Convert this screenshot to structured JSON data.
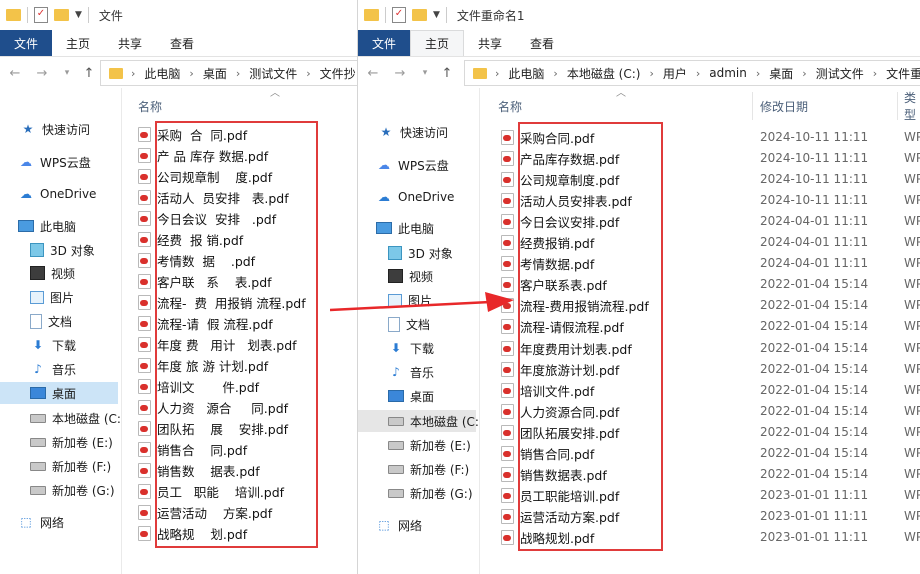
{
  "left": {
    "title": "文件",
    "ribbon_tabs": [
      "文件",
      "主页",
      "共享",
      "查看"
    ],
    "breadcrumb": [
      "此电脑",
      "桌面",
      "测试文件",
      "文件抄"
    ],
    "column_name": "名称",
    "nav": [
      {
        "label": "快速访问",
        "icon": "star-icon"
      },
      {
        "label": "WPS云盘",
        "icon": "cloud-icon"
      },
      {
        "label": "OneDrive",
        "icon": "onedrive-icon"
      },
      {
        "label": "此电脑",
        "icon": "pc-icon"
      },
      {
        "label": "3D 对象",
        "icon": "3d-objects-icon"
      },
      {
        "label": "视频",
        "icon": "video-icon"
      },
      {
        "label": "图片",
        "icon": "pictures-icon"
      },
      {
        "label": "文档",
        "icon": "documents-icon"
      },
      {
        "label": "下载",
        "icon": "download-icon"
      },
      {
        "label": "音乐",
        "icon": "music-icon"
      },
      {
        "label": "桌面",
        "icon": "desktop-icon"
      },
      {
        "label": "本地磁盘 (C:",
        "icon": "drive-icon"
      },
      {
        "label": "新加卷 (E:)",
        "icon": "drive-icon"
      },
      {
        "label": "新加卷 (F:)",
        "icon": "drive-icon"
      },
      {
        "label": "新加卷 (G:)",
        "icon": "drive-icon"
      },
      {
        "label": "网络",
        "icon": "network-icon"
      }
    ],
    "files": [
      "采购  合  同.pdf",
      "产 品 库存 数据.pdf",
      "公司规章制    度.pdf",
      "活动人  员安排   表.pdf",
      "今日会议  安排   .pdf",
      "经费  报 销.pdf",
      "考情数  据    .pdf",
      "客户联   系    表.pdf",
      "流程-  费  用报销 流程.pdf",
      "流程-请  假 流程.pdf",
      "年度 费   用计   划表.pdf",
      "年度 旅 游 计划.pdf",
      "培训文       件.pdf",
      "人力资   源合     同.pdf",
      "团队拓    展    安排.pdf",
      "销售合    同.pdf",
      "销售数    据表.pdf",
      "员工   职能    培训.pdf",
      "运营活动    方案.pdf",
      "战略规    划.pdf"
    ]
  },
  "right": {
    "title": "文件重命名1",
    "ribbon_tabs": [
      "文件",
      "主页",
      "共享",
      "查看"
    ],
    "breadcrumb": [
      "此电脑",
      "本地磁盘 (C:)",
      "用户",
      "admin",
      "桌面",
      "测试文件",
      "文件重"
    ],
    "column_name": "名称",
    "column_date": "修改日期",
    "column_type": "类型",
    "nav": [
      {
        "label": "快速访问",
        "icon": "star-icon"
      },
      {
        "label": "WPS云盘",
        "icon": "cloud-icon"
      },
      {
        "label": "OneDrive",
        "icon": "onedrive-icon"
      },
      {
        "label": "此电脑",
        "icon": "pc-icon"
      },
      {
        "label": "3D 对象",
        "icon": "3d-objects-icon"
      },
      {
        "label": "视频",
        "icon": "video-icon"
      },
      {
        "label": "图片",
        "icon": "pictures-icon"
      },
      {
        "label": "文档",
        "icon": "documents-icon"
      },
      {
        "label": "下载",
        "icon": "download-icon"
      },
      {
        "label": "音乐",
        "icon": "music-icon"
      },
      {
        "label": "桌面",
        "icon": "desktop-icon"
      },
      {
        "label": "本地磁盘 (C:",
        "icon": "drive-icon"
      },
      {
        "label": "新加卷 (E:)",
        "icon": "drive-icon"
      },
      {
        "label": "新加卷 (F:)",
        "icon": "drive-icon"
      },
      {
        "label": "新加卷 (G:)",
        "icon": "drive-icon"
      },
      {
        "label": "网络",
        "icon": "network-icon"
      }
    ],
    "files": [
      {
        "name": "采购合同.pdf",
        "date": "2024-10-11 11:11",
        "type": "WP"
      },
      {
        "name": "产品库存数据.pdf",
        "date": "2024-10-11 11:11",
        "type": "WP"
      },
      {
        "name": "公司规章制度.pdf",
        "date": "2024-10-11 11:11",
        "type": "WP"
      },
      {
        "name": "活动人员安排表.pdf",
        "date": "2024-10-11 11:11",
        "type": "WP"
      },
      {
        "name": "今日会议安排.pdf",
        "date": "2024-04-01 11:11",
        "type": "WP"
      },
      {
        "name": "经费报销.pdf",
        "date": "2024-04-01 11:11",
        "type": "WP"
      },
      {
        "name": "考情数据.pdf",
        "date": "2024-04-01 11:11",
        "type": "WP"
      },
      {
        "name": "客户联系表.pdf",
        "date": "2022-01-04 15:14",
        "type": "WP"
      },
      {
        "name": "流程-费用报销流程.pdf",
        "date": "2022-01-04 15:14",
        "type": "WP"
      },
      {
        "name": "流程-请假流程.pdf",
        "date": "2022-01-04 15:14",
        "type": "WP"
      },
      {
        "name": "年度费用计划表.pdf",
        "date": "2022-01-04 15:14",
        "type": "WP"
      },
      {
        "name": "年度旅游计划.pdf",
        "date": "2022-01-04 15:14",
        "type": "WP"
      },
      {
        "name": "培训文件.pdf",
        "date": "2022-01-04 15:14",
        "type": "WP"
      },
      {
        "name": "人力资源合同.pdf",
        "date": "2022-01-04 15:14",
        "type": "WP"
      },
      {
        "name": "团队拓展安排.pdf",
        "date": "2022-01-04 15:14",
        "type": "WP"
      },
      {
        "name": "销售合同.pdf",
        "date": "2022-01-04 15:14",
        "type": "WP"
      },
      {
        "name": "销售数据表.pdf",
        "date": "2022-01-04 15:14",
        "type": "WP"
      },
      {
        "name": "员工职能培训.pdf",
        "date": "2023-01-01 11:11",
        "type": "WP"
      },
      {
        "name": "运营活动方案.pdf",
        "date": "2023-01-01 11:11",
        "type": "WP"
      },
      {
        "name": "战略规划.pdf",
        "date": "2023-01-01 11:11",
        "type": "WP"
      }
    ]
  },
  "colors": {
    "highlight": "#e03b3b",
    "file_tab": "#1f4e8c",
    "selection": "#cce4f7"
  }
}
